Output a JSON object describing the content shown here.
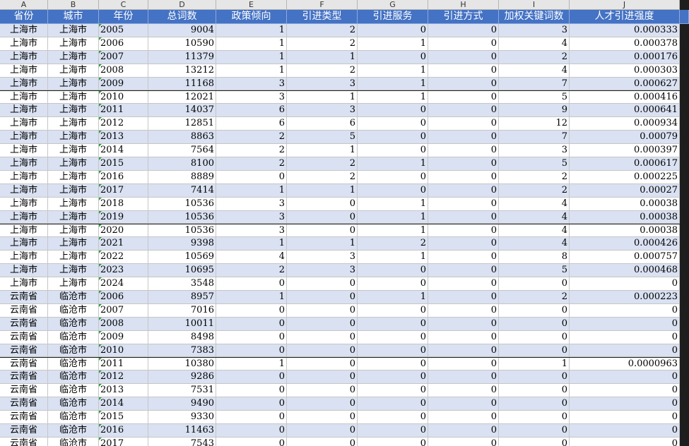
{
  "column_letters": [
    "A",
    "B",
    "C",
    "D",
    "E",
    "F",
    "G",
    "H",
    "I",
    "J"
  ],
  "headers": [
    "省份",
    "城市",
    "年份",
    "总词数",
    "政策倾向",
    "引进类型",
    "引进服务",
    "引进方式",
    "加权关键词数",
    "人才引进强度"
  ],
  "colors": {
    "header_bg": "#4472c4",
    "header_text": "#ffffff",
    "band": "#d9e1f2",
    "plain": "#ffffff",
    "grid": "#c6c6c6"
  },
  "rows": [
    [
      "上海市",
      "上海市",
      "2005",
      "9004",
      "1",
      "2",
      "0",
      "0",
      "3",
      "0.000333"
    ],
    [
      "上海市",
      "上海市",
      "2006",
      "10590",
      "1",
      "2",
      "1",
      "0",
      "4",
      "0.000378"
    ],
    [
      "上海市",
      "上海市",
      "2007",
      "11379",
      "1",
      "1",
      "0",
      "0",
      "2",
      "0.000176"
    ],
    [
      "上海市",
      "上海市",
      "2008",
      "13212",
      "1",
      "2",
      "1",
      "0",
      "4",
      "0.000303"
    ],
    [
      "上海市",
      "上海市",
      "2009",
      "11168",
      "3",
      "3",
      "1",
      "0",
      "7",
      "0.000627"
    ],
    [
      "上海市",
      "上海市",
      "2010",
      "12021",
      "3",
      "1",
      "1",
      "0",
      "5",
      "0.000416"
    ],
    [
      "上海市",
      "上海市",
      "2011",
      "14037",
      "6",
      "3",
      "0",
      "0",
      "9",
      "0.000641"
    ],
    [
      "上海市",
      "上海市",
      "2012",
      "12851",
      "6",
      "6",
      "0",
      "0",
      "12",
      "0.000934"
    ],
    [
      "上海市",
      "上海市",
      "2013",
      "8863",
      "2",
      "5",
      "0",
      "0",
      "7",
      "0.00079"
    ],
    [
      "上海市",
      "上海市",
      "2014",
      "7564",
      "2",
      "1",
      "0",
      "0",
      "3",
      "0.000397"
    ],
    [
      "上海市",
      "上海市",
      "2015",
      "8100",
      "2",
      "2",
      "1",
      "0",
      "5",
      "0.000617"
    ],
    [
      "上海市",
      "上海市",
      "2016",
      "8889",
      "0",
      "2",
      "0",
      "0",
      "2",
      "0.000225"
    ],
    [
      "上海市",
      "上海市",
      "2017",
      "7414",
      "1",
      "1",
      "0",
      "0",
      "2",
      "0.00027"
    ],
    [
      "上海市",
      "上海市",
      "2018",
      "10536",
      "3",
      "0",
      "1",
      "0",
      "4",
      "0.00038"
    ],
    [
      "上海市",
      "上海市",
      "2019",
      "10536",
      "3",
      "0",
      "1",
      "0",
      "4",
      "0.00038"
    ],
    [
      "上海市",
      "上海市",
      "2020",
      "10536",
      "3",
      "0",
      "1",
      "0",
      "4",
      "0.00038"
    ],
    [
      "上海市",
      "上海市",
      "2021",
      "9398",
      "1",
      "1",
      "2",
      "0",
      "4",
      "0.000426"
    ],
    [
      "上海市",
      "上海市",
      "2022",
      "10569",
      "4",
      "3",
      "1",
      "0",
      "8",
      "0.000757"
    ],
    [
      "上海市",
      "上海市",
      "2023",
      "10695",
      "2",
      "3",
      "0",
      "0",
      "5",
      "0.000468"
    ],
    [
      "上海市",
      "上海市",
      "2024",
      "3548",
      "0",
      "0",
      "0",
      "0",
      "0",
      "0"
    ],
    [
      "云南省",
      "临沧市",
      "2006",
      "8957",
      "1",
      "0",
      "1",
      "0",
      "2",
      "0.000223"
    ],
    [
      "云南省",
      "临沧市",
      "2007",
      "7016",
      "0",
      "0",
      "0",
      "0",
      "0",
      "0"
    ],
    [
      "云南省",
      "临沧市",
      "2008",
      "10011",
      "0",
      "0",
      "0",
      "0",
      "0",
      "0"
    ],
    [
      "云南省",
      "临沧市",
      "2009",
      "8498",
      "0",
      "0",
      "0",
      "0",
      "0",
      "0"
    ],
    [
      "云南省",
      "临沧市",
      "2010",
      "7383",
      "0",
      "0",
      "0",
      "0",
      "0",
      "0"
    ],
    [
      "云南省",
      "临沧市",
      "2011",
      "10380",
      "1",
      "0",
      "0",
      "0",
      "1",
      "0.0000963"
    ],
    [
      "云南省",
      "临沧市",
      "2012",
      "9286",
      "0",
      "0",
      "0",
      "0",
      "0",
      "0"
    ],
    [
      "云南省",
      "临沧市",
      "2013",
      "7531",
      "0",
      "0",
      "0",
      "0",
      "0",
      "0"
    ],
    [
      "云南省",
      "临沧市",
      "2014",
      "9490",
      "0",
      "0",
      "0",
      "0",
      "0",
      "0"
    ],
    [
      "云南省",
      "临沧市",
      "2015",
      "9330",
      "0",
      "0",
      "0",
      "0",
      "0",
      "0"
    ],
    [
      "云南省",
      "临沧市",
      "2016",
      "11463",
      "0",
      "0",
      "0",
      "0",
      "0",
      "0"
    ],
    [
      "云南省",
      "临沧市",
      "2017",
      "7543",
      "0",
      "0",
      "0",
      "0",
      "0",
      "0"
    ]
  ]
}
